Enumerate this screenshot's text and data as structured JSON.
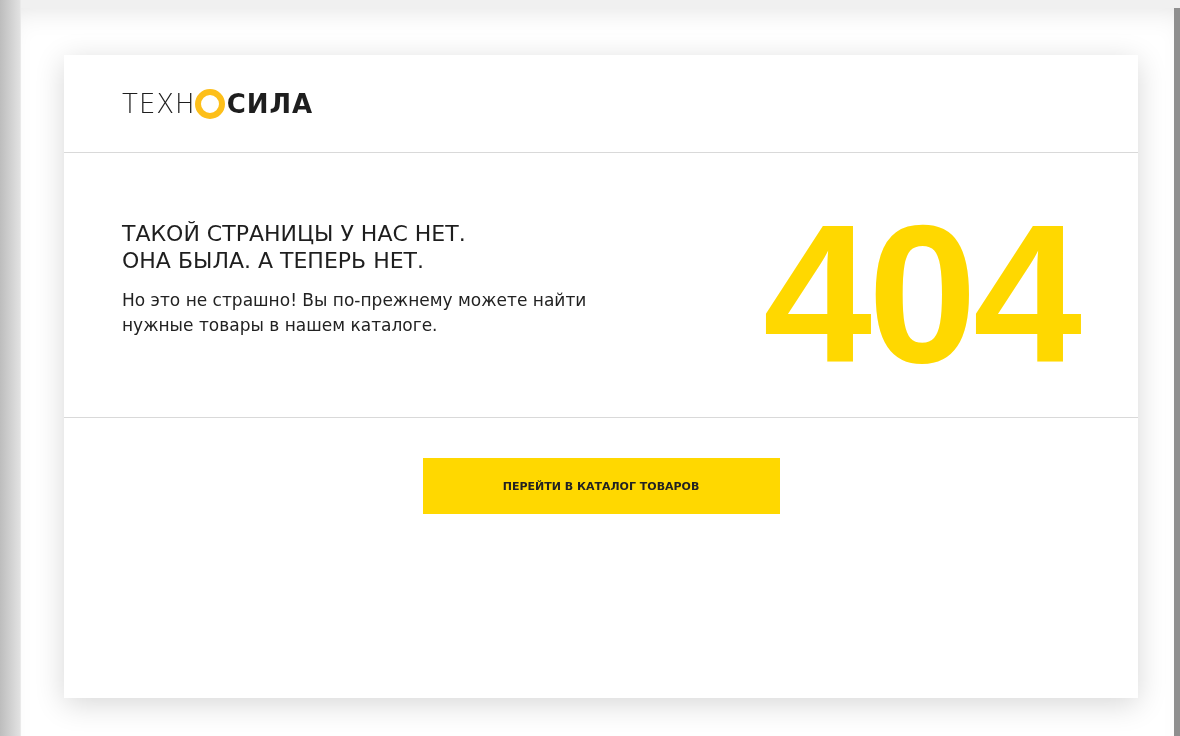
{
  "logo": {
    "left": "ТЕХН",
    "right": "СИЛА"
  },
  "heading": [
    "ТАКОЙ СТРАНИЦЫ У НАС НЕТ.",
    "ОНА БЫЛА. А ТЕПЕРЬ НЕТ."
  ],
  "message": "Но это не страшно! Вы по-прежнему можете найти нужные товары в нашем каталоге.",
  "error_code": "404",
  "button": "ПЕРЕЙТИ В КАТАЛОГ ТОВАРОВ"
}
